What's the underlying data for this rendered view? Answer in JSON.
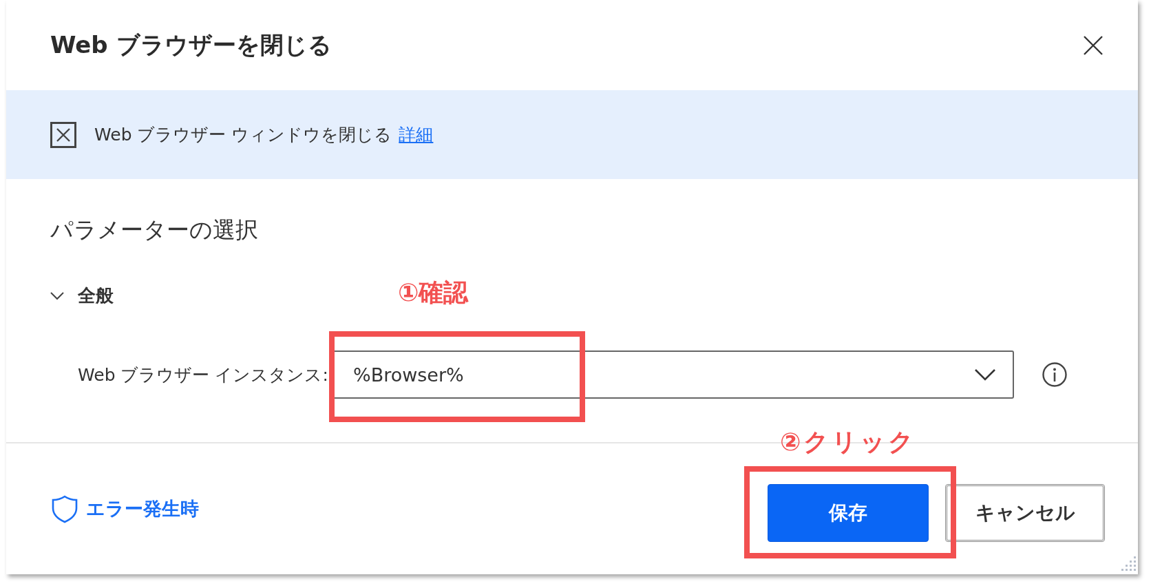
{
  "dialog": {
    "title": "Web ブラウザーを閉じる"
  },
  "banner": {
    "description": "Web ブラウザー ウィンドウを閉じる",
    "link": "詳細"
  },
  "section": {
    "heading": "パラメーターの選択",
    "group": {
      "label": "全般",
      "expanded": true
    },
    "fields": [
      {
        "label": "Web ブラウザー インスタンス:",
        "value": "%Browser%",
        "annotation": "①確認"
      }
    ]
  },
  "footer": {
    "error_link": "エラー発生時",
    "buttons": [
      {
        "label": "保存",
        "kind": "primary"
      },
      {
        "label": "キャンセル",
        "kind": "secondary"
      }
    ],
    "annotation": "②クリック"
  }
}
